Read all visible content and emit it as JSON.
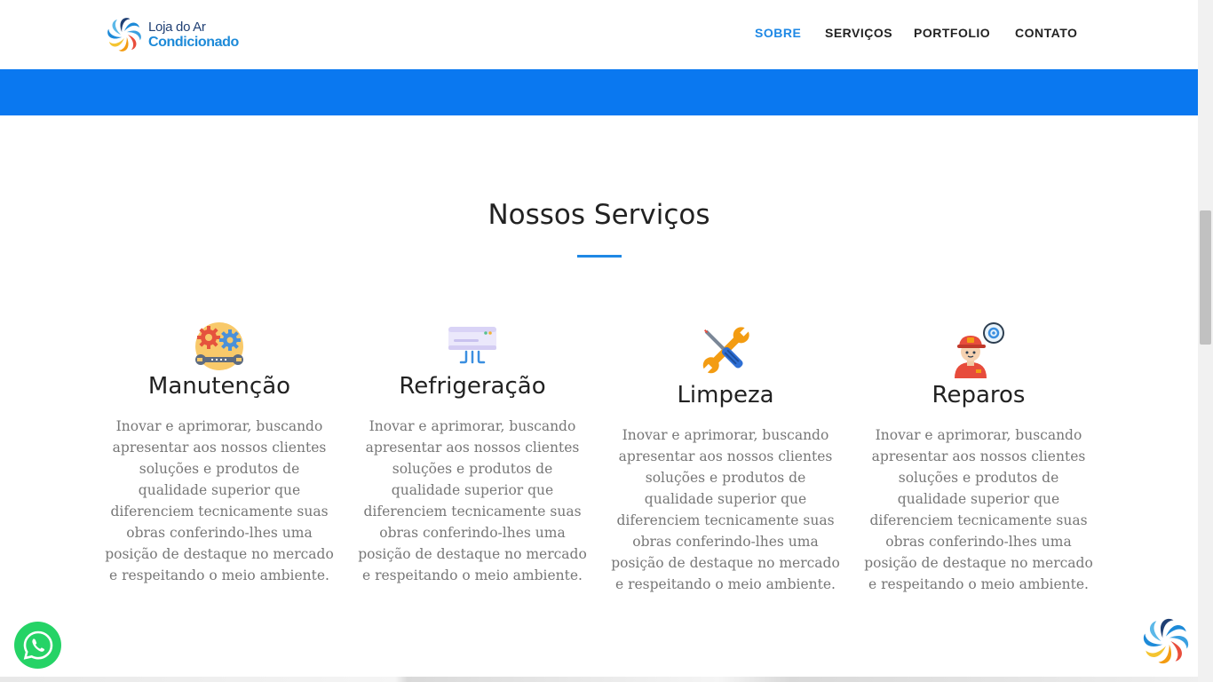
{
  "header": {
    "logo": {
      "line1": "Loja do Ar",
      "line2": "Condicionado"
    },
    "nav": [
      {
        "label": "SOBRE",
        "active": true
      },
      {
        "label": "SERVIÇOS",
        "active": false
      },
      {
        "label": "PORTFOLIO",
        "active": false
      },
      {
        "label": "CONTATO",
        "active": false
      }
    ]
  },
  "colors": {
    "accent": "#1e88e5",
    "band": "#0a78f0",
    "whatsapp": "#25d366"
  },
  "services": {
    "title": "Nossos Serviços",
    "items": [
      {
        "icon": "gears-wrench-icon",
        "title": "Manutenção",
        "text": "Inovar e aprimorar, buscando apresentar aos nossos clientes soluções e produtos de qualidade superior que diferenciem tecnicamente suas obras conferindo-lhes uma posição de destaque no mercado e respeitando o meio ambiente."
      },
      {
        "icon": "air-conditioner-icon",
        "title": "Refrigeração",
        "text": "Inovar e aprimorar, buscando apresentar aos nossos clientes soluções e produtos de qualidade superior que diferenciem tecnicamente suas obras conferindo-lhes uma posição de destaque no mercado e respeitando o meio ambiente."
      },
      {
        "icon": "wrench-screwdriver-icon",
        "title": "Limpeza",
        "text": "Inovar e aprimorar, buscando apresentar aos nossos clientes soluções e produtos de qualidade superior que diferenciem tecnicamente suas obras conferindo-lhes uma posição de destaque no mercado e respeitando o meio ambiente."
      },
      {
        "icon": "technician-icon",
        "title": "Reparos",
        "text": "Inovar e aprimorar, buscando apresentar aos nossos clientes soluções e produtos de qualidade superior que diferenciem tecnicamente suas obras conferindo-lhes uma posição de destaque no mercado e respeitando o meio ambiente."
      }
    ]
  },
  "floating": {
    "whatsapp_icon": "whatsapp-icon",
    "logo_icon": "brand-swirl-icon"
  }
}
